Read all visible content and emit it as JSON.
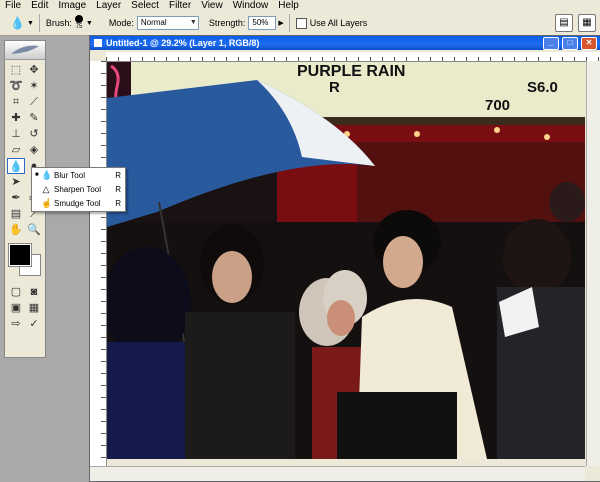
{
  "menu": [
    "File",
    "Edit",
    "Image",
    "Layer",
    "Select",
    "Filter",
    "View",
    "Window",
    "Help"
  ],
  "options": {
    "brush_label": "Brush:",
    "brush_size": "75",
    "mode_label": "Mode:",
    "mode_value": "Normal",
    "strength_label": "Strength:",
    "strength_value": "50%",
    "use_all_layers": "Use All Layers"
  },
  "document": {
    "title": "Untitled-1 @ 29.2% (Layer 1, RGB/8)",
    "marquee_line1": "PURPLE RAIN",
    "marquee_line2": "R",
    "marquee_line3": "S6.0",
    "marquee_line4": "700"
  },
  "flyout": [
    {
      "label": "Blur Tool",
      "shortcut": "R",
      "icon": "drop-icon",
      "selected": true
    },
    {
      "label": "Sharpen Tool",
      "shortcut": "R",
      "icon": "cone-icon",
      "selected": false
    },
    {
      "label": "Smudge Tool",
      "shortcut": "R",
      "icon": "finger-icon",
      "selected": false
    }
  ],
  "colors": {
    "foreground": "#000000",
    "background": "#ffffff",
    "titlebar": "#1f6df2"
  }
}
